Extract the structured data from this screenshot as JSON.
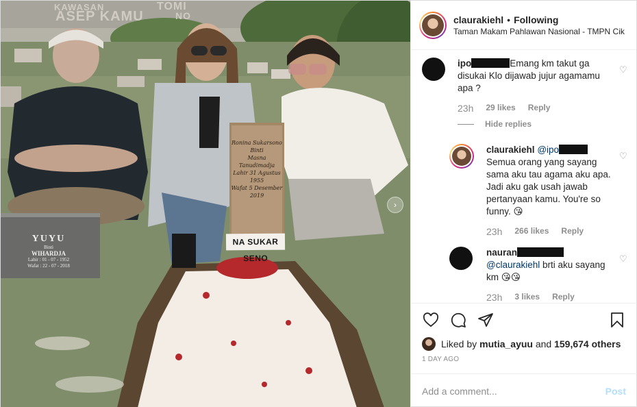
{
  "post": {
    "username": "claurakiehl",
    "separator": "•",
    "follow_status": "Following",
    "location": "Taman Makam Pahlawan Nasional - TMPN Cik..."
  },
  "photo": {
    "wall_text_1": "KAWASAN",
    "wall_text_2": "ASEP KAMU",
    "wall_text_3": "TOMI",
    "wall_text_4": "NO",
    "headstone": {
      "name": "YUYU",
      "binti": "Binti",
      "father": "WIHARDJA",
      "born": "Lahir : 01 - 07 - 1952",
      "died": "Wafat : 22 - 07 - 2018"
    },
    "cross_lines": [
      "Ronina Sukarsono",
      "Binti",
      "Masna Tanudimadja",
      "Lahir 31 Agustus 1955",
      "Wafat 5 Desember 2019"
    ],
    "ribbon": "NA SUKAR SENO",
    "carousel_icon": "chevron-right-icon"
  },
  "comments": [
    {
      "username": "ipo",
      "text": "Emang km takut ga disukai Klo dijawab jujur agamamu apa ?",
      "time": "23h",
      "likes": "29 likes",
      "reply": "Reply"
    },
    {
      "hide_replies": "Hide replies"
    },
    {
      "username": "claurakiehl",
      "mention": "@ipo",
      "text": "Semua orang yang sayang sama aku tau agama aku apa. Jadi aku gak usah jawab pertanyaan kamu. You're so funny. 😘",
      "time": "23h",
      "likes": "266 likes",
      "reply": "Reply"
    },
    {
      "username": "nauran",
      "mention": "@claurakiehl",
      "text": " brti aku sayang km 😘😘",
      "time": "23h",
      "likes": "3 likes",
      "reply": "Reply"
    }
  ],
  "actions": {
    "liked_by_prefix": "Liked by ",
    "liked_by_user": "mutia_ayuu",
    "liked_by_and": " and ",
    "liked_by_count": "159,674 others",
    "time_ago": "1 DAY AGO"
  },
  "add_comment": {
    "placeholder": "Add a comment...",
    "post_label": "Post"
  },
  "colors": {
    "link": "#00376b",
    "muted": "#8e8e8e",
    "post_button": "#b2dffc"
  }
}
